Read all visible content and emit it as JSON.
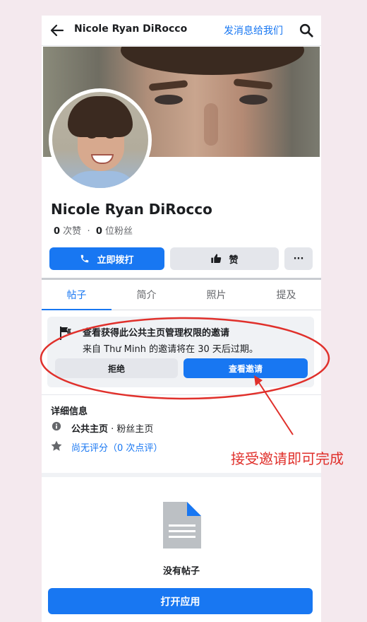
{
  "top_bar": {
    "title": "Nicole Ryan DiRocco",
    "message_link": "发消息给我们",
    "icons": [
      "back-arrow-icon",
      "search-icon"
    ]
  },
  "profile": {
    "name": "Nicole Ryan DiRocco",
    "likes_count": "0",
    "likes_label": " 次赞",
    "dot": "·",
    "followers_count": "0",
    "followers_label": " 位粉丝"
  },
  "actions": {
    "call_label": "立即拨打",
    "like_label": "赞",
    "more_label": "···"
  },
  "tabs": [
    {
      "label": "帖子",
      "active": true
    },
    {
      "label": "简介",
      "active": false
    },
    {
      "label": "照片",
      "active": false
    },
    {
      "label": "提及",
      "active": false
    }
  ],
  "invite": {
    "title": "查看获得此公共主页管理权限的邀请",
    "subtitle": "来自 Thư Minh 的邀请将在 30 天后过期。",
    "decline_label": "拒绝",
    "view_label": "查看邀请"
  },
  "details": {
    "title": "详细信息",
    "category_bold": "公共主页",
    "category_rest": " · 粉丝主页",
    "rating_text": "尚无评分（0 次点评）"
  },
  "empty_state": {
    "label": "没有帖子"
  },
  "bottom": {
    "open_app_label": "打开应用"
  },
  "annotation": {
    "text": "接受邀请即可完成",
    "color": "#e0302b"
  },
  "colors": {
    "accent": "#1877f2",
    "page_background": "#f4e9ee"
  }
}
